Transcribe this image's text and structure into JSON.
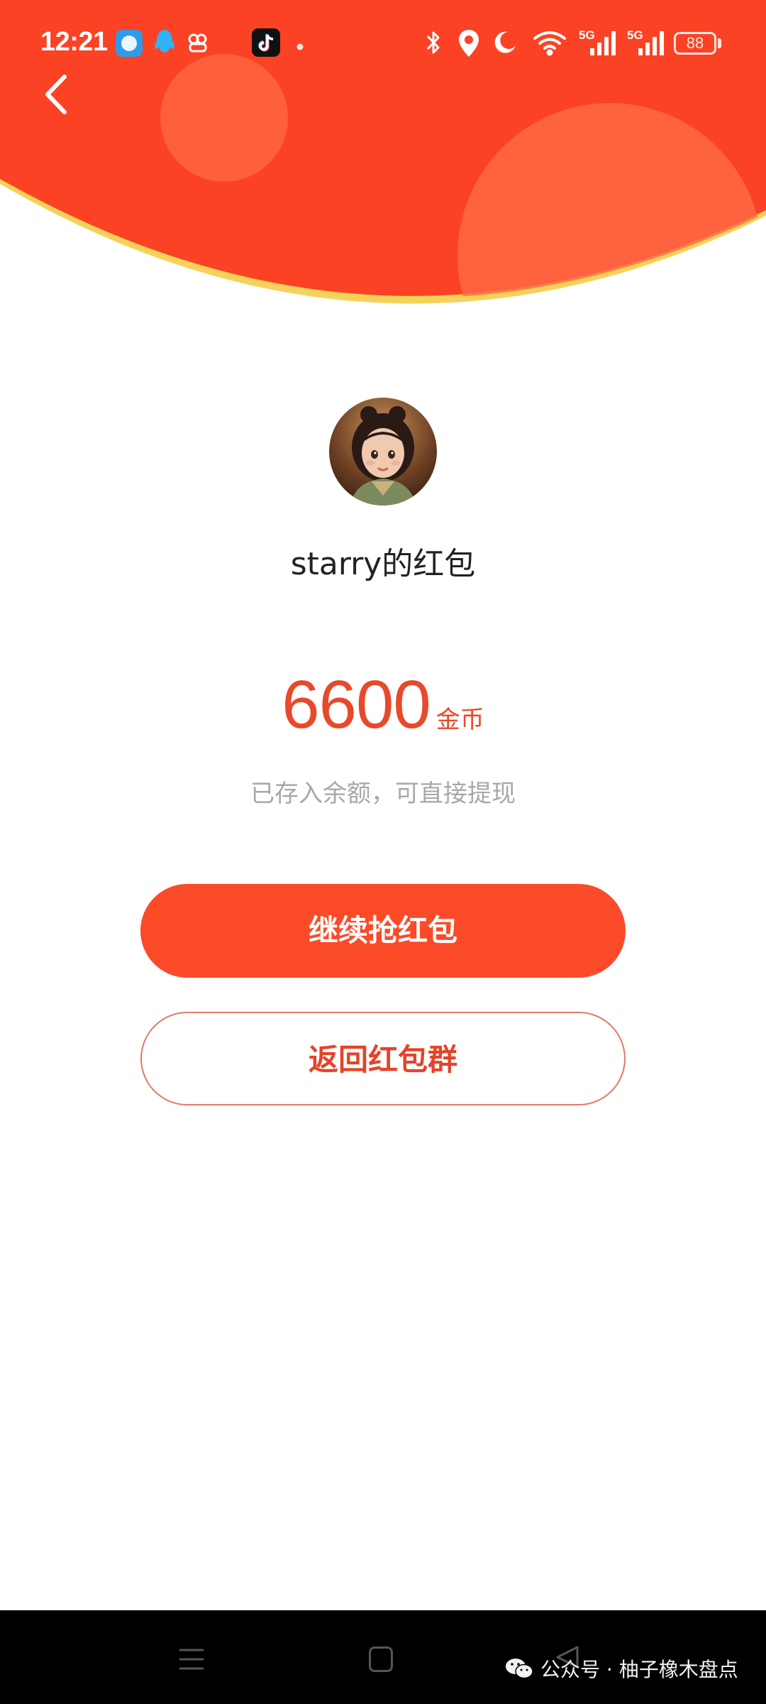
{
  "status_bar": {
    "time": "12:21",
    "network_label_1": "5G",
    "network_label_2": "5G",
    "battery": "88"
  },
  "header": {
    "back_icon": "chevron-left-icon",
    "colors": {
      "red": "#fb4224",
      "bubble": "#ff6a45",
      "rim": "#f9d86a"
    }
  },
  "sender": {
    "title": "starry的红包"
  },
  "reward": {
    "amount": "6600",
    "unit": "金币",
    "note": "已存入余额，可直接提现",
    "accent": "#e8492b"
  },
  "actions": {
    "continue_label": "继续抢红包",
    "back_group_label": "返回红包群"
  },
  "watermark": {
    "text": "公众号 · 柚子橡木盘点"
  }
}
